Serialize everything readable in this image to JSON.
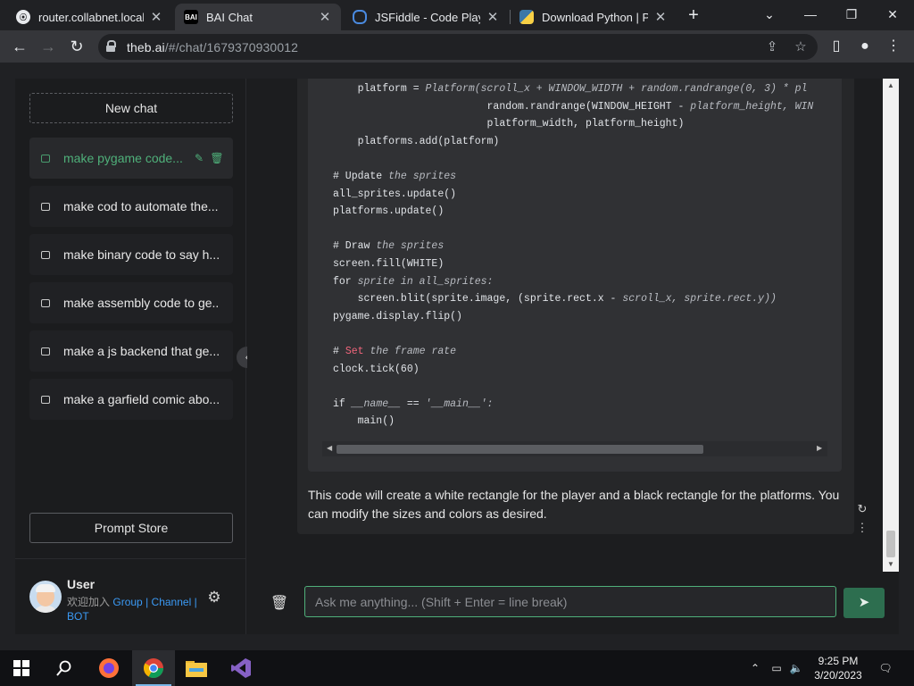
{
  "browser": {
    "tabs": [
      {
        "title": "router.collabnet.local -",
        "icon": "router-favicon-icon"
      },
      {
        "title": "BAI Chat",
        "icon": "bai-favicon-icon",
        "favicon_text": "BAI"
      },
      {
        "title": "JSFiddle - Code Playgro",
        "icon": "jsfiddle-favicon-icon"
      },
      {
        "title": "Download Python | Pyt",
        "icon": "python-favicon-icon"
      }
    ],
    "url_host": "theb.ai",
    "url_path": "/#/chat/1679370930012"
  },
  "sidebar": {
    "new_chat_label": "New chat",
    "chats": [
      {
        "label": "make pygame code...",
        "active": true
      },
      {
        "label": "make cod to automate the..."
      },
      {
        "label": "make binary code to say h..."
      },
      {
        "label": "make assembly code to ge..."
      },
      {
        "label": "make a js backend that ge..."
      },
      {
        "label": "make a garfield comic abo..."
      }
    ],
    "prompt_store_label": "Prompt Store",
    "user": {
      "name": "User",
      "join_text": "欢迎加入",
      "link_group": "Group",
      "link_channel": "Channel",
      "sep": "|",
      "link_bot": "BOT"
    }
  },
  "chat": {
    "code_lines": [
      "    platform = <i>Platform(scroll_x + WINDOW_WIDTH + random.randrange(0, 3) * pl</i>",
      "                         random.randrange(WINDOW_HEIGHT - <i>platform_height, WIN</i>",
      "                         platform_width, platform_height)",
      "    platforms.add(platform)",
      "",
      "# Update <i>the sprites</i>",
      "all_sprites.update()",
      "platforms.update()",
      "",
      "# Draw <i>the sprites</i>",
      "screen.fill(WHITE)",
      "for <i>sprite in all_sprites:</i>",
      "    screen.blit(sprite.image, (sprite.rect.x - <i>scroll_x, sprite.rect.y))</i>",
      "pygame.display.flip()",
      "",
      "# <k>Set</k> <i>the frame rate</i>",
      "clock.tick(60)",
      "",
      "if <i>__name__</i> == <i>'__main__':</i>",
      "    main()"
    ],
    "answer": "This code will create a white rectangle for the player and a black rectangle for the platforms. You can modify the sizes and colors as desired.",
    "input_placeholder": "Ask me anything... (Shift + Enter = line break)",
    "input_value": ""
  },
  "taskbar": {
    "time": "9:25 PM",
    "date": "3/20/2023",
    "apps": [
      "start-icon",
      "search-icon",
      "firefox-icon",
      "chrome-icon",
      "file-explorer-icon",
      "visual-studio-icon"
    ]
  },
  "colors": {
    "accent_green": "#4fb07a",
    "send_button": "#2d6e4f",
    "link_blue": "#3b9af5",
    "code_keyword_red": "#f0657b"
  }
}
